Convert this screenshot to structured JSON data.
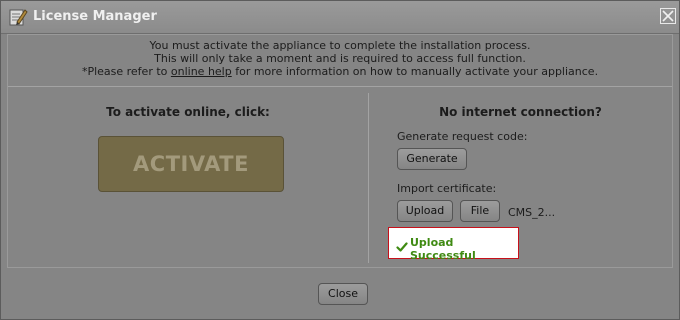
{
  "window": {
    "title": "License Manager",
    "title_icon": "pencil-edit-icon",
    "close_icon": "close-icon"
  },
  "notice": {
    "line1": "You must activate the appliance to complete the installation process.",
    "line2": "This will only take a moment and is required to access full function.",
    "line3_prefix": "*Please refer to ",
    "line3_link": "online help",
    "line3_suffix": " for more information on how to manually activate your appliance."
  },
  "online": {
    "heading": "To activate online, click:",
    "activate_label": "ACTIVATE"
  },
  "offline": {
    "heading": "No internet connection?",
    "generate_label": "Generate request code:",
    "generate_button": "Generate",
    "import_label": "Import certificate:",
    "upload_button": "Upload",
    "file_button": "File",
    "file_name": "CMS_2...",
    "status_icon": "checkmark-icon",
    "status_text": "Upload Successful"
  },
  "footer": {
    "close_button": "Close"
  },
  "colors": {
    "overlay_gray": "#858585",
    "activate_bg": "#746a47",
    "success_text": "#3f8a12",
    "success_border": "#c8101a"
  }
}
